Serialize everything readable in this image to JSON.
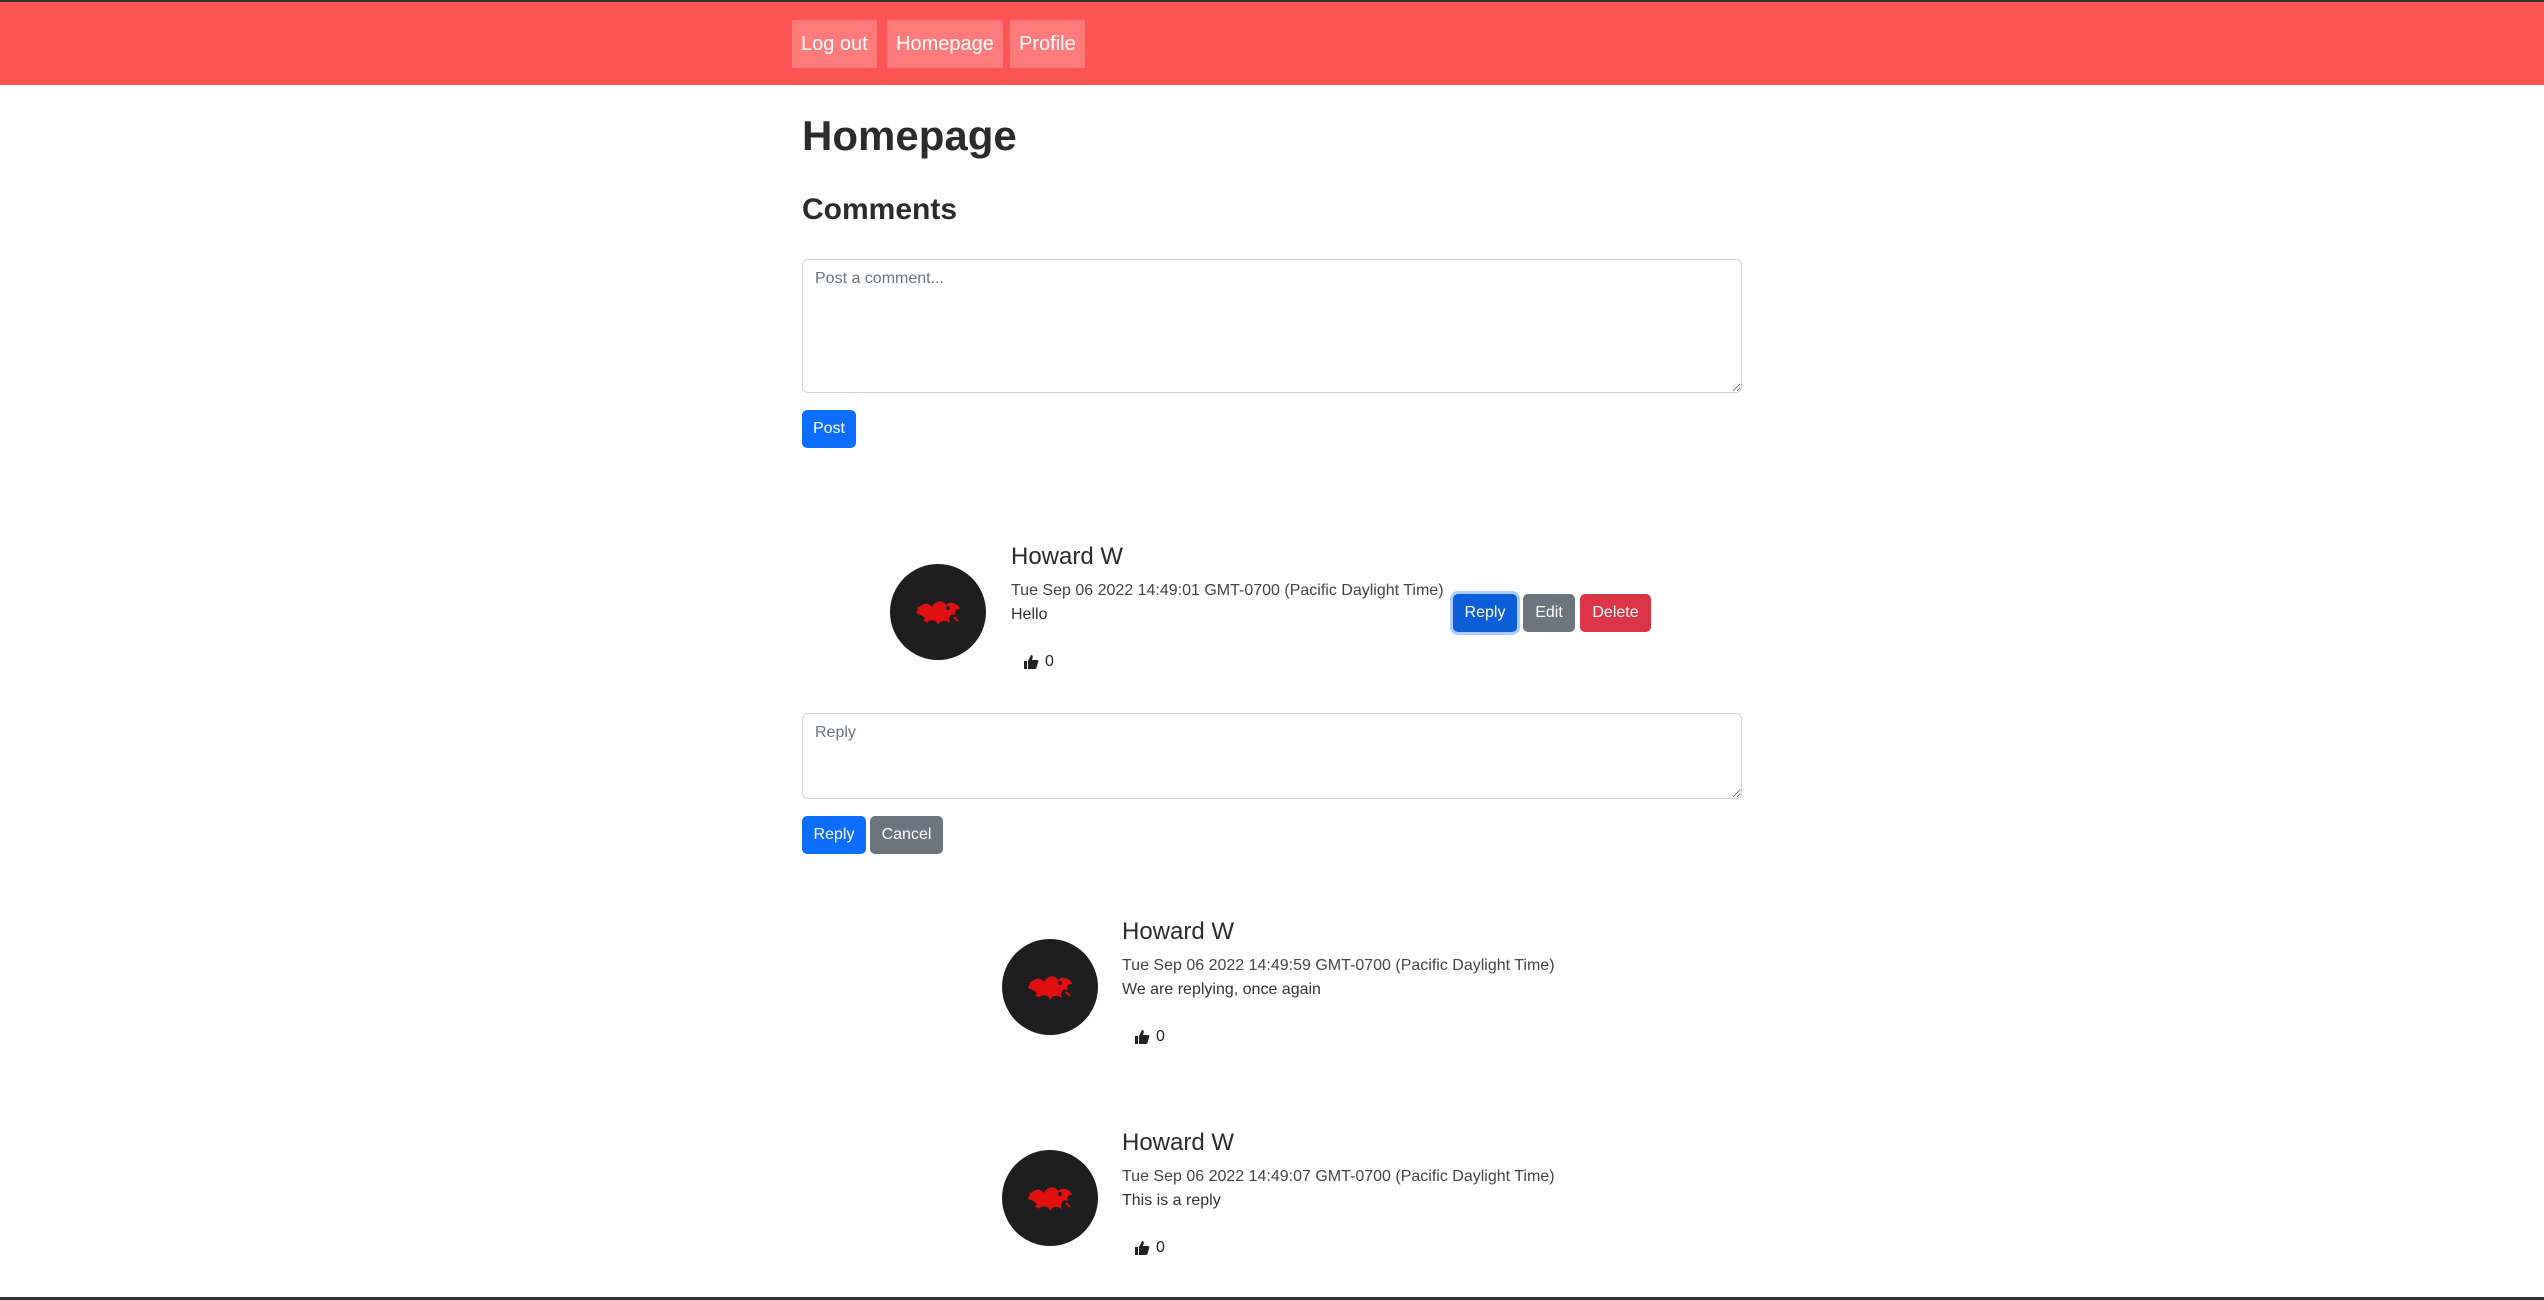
{
  "nav": {
    "logout": "Log out",
    "homepage": "Homepage",
    "profile": "Profile"
  },
  "page": {
    "title": "Homepage",
    "comments_heading": "Comments"
  },
  "composer": {
    "placeholder": "Post a comment...",
    "post_label": "Post"
  },
  "comments": [
    {
      "author": "Howard W",
      "date": "Tue Sep 06 2022 14:49:01 GMT-0700 (Pacific Daylight Time)",
      "text": "Hello",
      "likes": "0",
      "actions": {
        "reply": "Reply",
        "edit": "Edit",
        "delete": "Delete"
      }
    },
    {
      "author": "Howard W",
      "date": "Tue Sep 06 2022 14:49:59 GMT-0700 (Pacific Daylight Time)",
      "text": "We are replying, once again",
      "likes": "0"
    },
    {
      "author": "Howard W",
      "date": "Tue Sep 06 2022 14:49:07 GMT-0700 (Pacific Daylight Time)",
      "text": "This is a reply",
      "likes": "0"
    }
  ],
  "reply_form": {
    "placeholder": "Reply",
    "reply_label": "Reply",
    "cancel_label": "Cancel"
  },
  "colors": {
    "navbar": "#ff5454",
    "primary": "#0d6efd",
    "secondary": "#6c757d",
    "danger": "#dc3545"
  },
  "icons": {
    "avatar": "red-dragon-icon",
    "like": "thumbs-up-icon"
  }
}
